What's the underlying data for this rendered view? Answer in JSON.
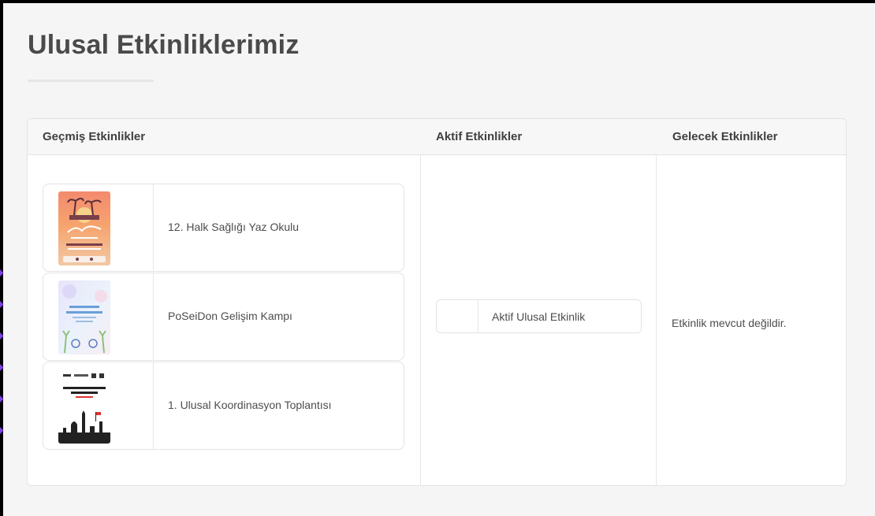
{
  "page": {
    "title": "Ulusal Etkinliklerimiz"
  },
  "columns": {
    "past": {
      "heading": "Geçmiş Etkinlikler"
    },
    "active": {
      "heading": "Aktif Etkinlikler"
    },
    "future": {
      "heading": "Gelecek Etkinlikler"
    }
  },
  "past_events": [
    {
      "name": "12. Halk Sağlığı Yaz Okulu"
    },
    {
      "name": "PoSeiDon Gelişim Kampı"
    },
    {
      "name": "1. Ulusal Koordinasyon Toplantısı"
    }
  ],
  "active_events": [
    {
      "name": "Aktif Ulusal Etkinlik"
    }
  ],
  "future_events": {
    "empty_message": "Etkinlik mevcut değildir."
  },
  "theme": {
    "title_color": "#4a4a4a",
    "header_bg": "#f7f7f7",
    "border": "#e3e3e3",
    "marker": "#7b3fe4"
  }
}
